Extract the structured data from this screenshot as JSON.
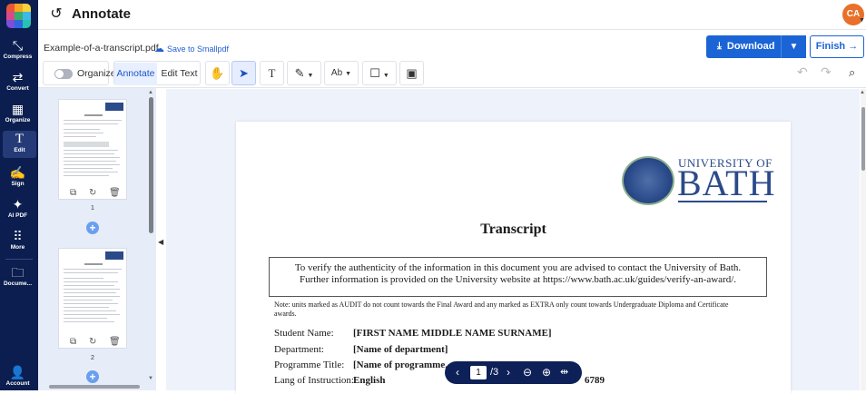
{
  "app": {
    "title": "Annotate",
    "user_initials": "CA"
  },
  "nav": {
    "items": [
      {
        "label": "Compress",
        "icon": "compress-icon"
      },
      {
        "label": "Convert",
        "icon": "convert-icon"
      },
      {
        "label": "Organize",
        "icon": "organize-icon"
      },
      {
        "label": "Edit",
        "icon": "edit-icon"
      },
      {
        "label": "Sign",
        "icon": "sign-icon"
      },
      {
        "label": "AI PDF",
        "icon": "ai-sparkle-icon"
      },
      {
        "label": "More",
        "icon": "more-grid-icon"
      },
      {
        "label": "Docume...",
        "icon": "folder-icon"
      },
      {
        "label": "Account",
        "icon": "account-icon"
      }
    ],
    "active": "Edit"
  },
  "file": {
    "name": "Example-of-a-transcript.pdf",
    "save_label": "Save to Smallpdf"
  },
  "actions": {
    "download": "Download",
    "finish": "Finish"
  },
  "toolbar": {
    "organize_label": "Organize",
    "annotate_label": "Annotate",
    "edit_text_label": "Edit Text",
    "active_tool": "select-arrow"
  },
  "thumbnails": [
    {
      "page": "1"
    },
    {
      "page": "2"
    }
  ],
  "document": {
    "crest_label": "UNIVERSITY OF",
    "brand": "BATH",
    "title": "Transcript",
    "verify_text": "To verify the authenticity of the information in this document you are advised to contact the University of Bath. Further information is provided on the University website at https://www.bath.ac.uk/guides/verify-an-award/.",
    "note": "Note: units marked as AUDIT do not count towards the Final Award and any marked as EXTRA only count towards Undergraduate Diploma and Certificate awards.",
    "fields": [
      {
        "label": "Student Name:",
        "value": "[FIRST NAME MIDDLE NAME SURNAME]"
      },
      {
        "label": "Department:",
        "value": "[Name of department]"
      },
      {
        "label": "Programme Title:",
        "value": "[Name of programme, e"
      },
      {
        "label": "Lang of Instruction:",
        "value": "English"
      }
    ],
    "partial_text": "6789"
  },
  "pager": {
    "current": "1",
    "total": "/3"
  },
  "colors": {
    "rail": "#0b1e4f",
    "accent": "#1a64d6",
    "avatar": "#e8702a"
  }
}
